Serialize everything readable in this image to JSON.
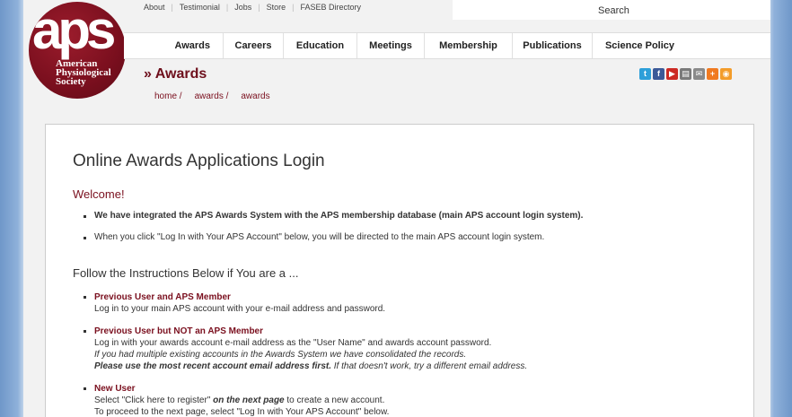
{
  "header": {
    "top_links": [
      "About",
      "Testimonial",
      "Jobs",
      "Store",
      "FASEB Directory"
    ],
    "search_label": "Search",
    "logo": {
      "text": "aps",
      "tag_lines": [
        "American",
        "Physiological",
        "Society"
      ]
    },
    "nav": [
      "Awards",
      "Careers",
      "Education",
      "Meetings",
      "Membership",
      "Publications",
      "Science Policy"
    ],
    "section_title": "» Awards",
    "breadcrumb": [
      "home /",
      "awards /",
      "awards"
    ],
    "social_icons": [
      "twitter-icon",
      "facebook-icon",
      "youtube-icon",
      "print-icon",
      "email-icon",
      "share-plus-icon",
      "rss-icon"
    ]
  },
  "content": {
    "title": "Online Awards Applications Login",
    "welcome_heading": "Welcome!",
    "welcome_items": [
      "We have integrated the APS Awards System with the APS membership database (main APS account login system).",
      "When you click \"Log In with Your APS Account\" below, you will be directed to the main APS account login system."
    ],
    "instructions_heading": "Follow the Instructions Below if You are a ...",
    "prev_member": {
      "title": "Previous User and APS Member",
      "line1": "Log in to your main APS account with your e-mail address and password."
    },
    "prev_nonmember": {
      "title": "Previous User but NOT an APS Member",
      "line1": "Log in with your awards account e-mail address as the \"User Name\" and awards account password.",
      "line2": "If you had multiple existing accounts in the Awards System we have consolidated the records.",
      "line3_bold": "Please use the most recent account email address first.",
      "line3_rest": " If that doesn't work, try a different email address."
    },
    "new_user": {
      "title": "New User",
      "line1_a": "Select \"Click here to register\" ",
      "line1_b": "on the next page",
      "line1_c": " to create a new account.",
      "line2": "To proceed to the next page, select \"Log In with Your APS Account\" below."
    }
  },
  "colors": {
    "brand": "#7a0f1e",
    "twitter": "#2d9fd9",
    "facebook": "#3b5998",
    "youtube": "#cc2a24",
    "print": "#7a7a7a",
    "email": "#8a8a8a",
    "share": "#f07a20",
    "rss": "#f39c2a"
  }
}
